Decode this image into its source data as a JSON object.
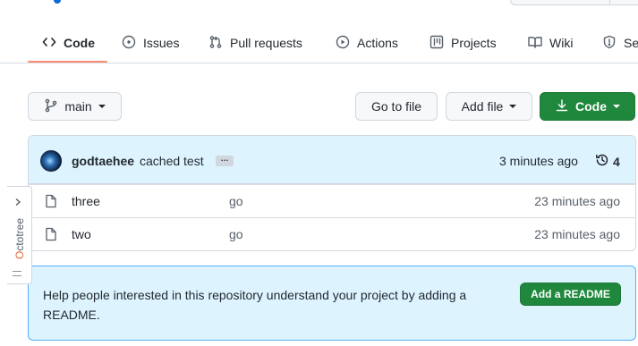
{
  "tabs": [
    {
      "label": "Code",
      "icon": "code-icon"
    },
    {
      "label": "Issues",
      "icon": "issue-icon"
    },
    {
      "label": "Pull requests",
      "icon": "pull-request-icon"
    },
    {
      "label": "Actions",
      "icon": "play-icon"
    },
    {
      "label": "Projects",
      "icon": "project-icon"
    },
    {
      "label": "Wiki",
      "icon": "book-icon"
    },
    {
      "label": "Se",
      "icon": "shield-icon"
    }
  ],
  "toolbar": {
    "branch_label": "main",
    "go_to_file_label": "Go to file",
    "add_file_label": "Add file",
    "code_label": "Code"
  },
  "commit": {
    "author": "godtaehee",
    "message": "cached test",
    "ellipsis": "…",
    "time": "3 minutes ago",
    "count": "4"
  },
  "files": [
    {
      "name": "three",
      "message": "go",
      "time": "23 minutes ago"
    },
    {
      "name": "two",
      "message": "go",
      "time": "23 minutes ago"
    }
  ],
  "readme": {
    "text": "Help people interested in this repository understand your project by adding a README.",
    "button_label": "Add a README"
  },
  "octotree": {
    "label_first": "O",
    "label_rest": "ctotree"
  },
  "colors": {
    "accent_green": "#1f883d",
    "tab_underline": "#fd8c73",
    "commit_bar_bg": "#ddf4ff",
    "readme_border": "#54aeff"
  }
}
